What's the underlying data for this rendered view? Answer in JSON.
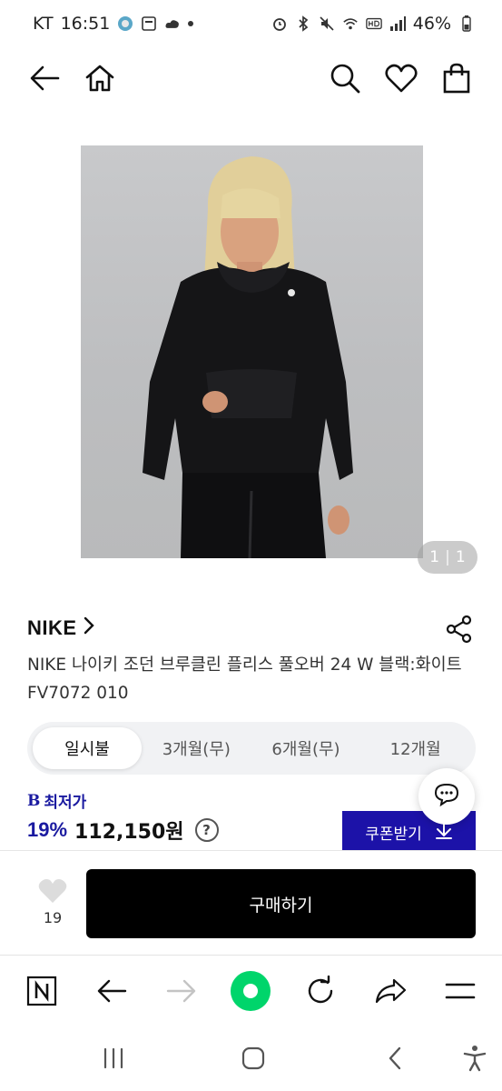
{
  "status_bar": {
    "carrier": "KT",
    "time": "16:51",
    "battery": "46%"
  },
  "product": {
    "brand": "NIKE",
    "title": "NIKE 나이키 조던 브루클린 플리스 풀오버 24 W 블랙:화이트 FV7072 010",
    "image_pager": {
      "current": "1",
      "total": "1"
    }
  },
  "tabs": [
    {
      "label": "일시불",
      "active": true
    },
    {
      "label": "3개월(무)",
      "active": false
    },
    {
      "label": "6개월(무)",
      "active": false
    },
    {
      "label": "12개월",
      "active": false
    }
  ],
  "price": {
    "lowest_prefix": "B",
    "lowest_label": "최저가",
    "discount": "19%",
    "amount": "112,150원",
    "help_symbol": "?"
  },
  "coupon_label": "쿠폰받기",
  "buy_bar": {
    "like_count": "19",
    "buy_label": "구매하기"
  },
  "colors": {
    "accent_blue": "#1c12a8",
    "buy_button": "#000000",
    "browser_home": "#00d56b"
  },
  "icons": {
    "appbar": [
      "back-arrow-icon",
      "home-icon",
      "search-icon",
      "heart-icon",
      "shopping-bag-icon"
    ],
    "browser": [
      "naver-n-icon",
      "back-icon",
      "forward-icon",
      "home-circle-icon",
      "refresh-icon",
      "share-icon",
      "menu-icon"
    ],
    "android_nav": [
      "recent-apps-icon",
      "home-nav-icon",
      "back-nav-icon",
      "accessibility-icon"
    ]
  }
}
